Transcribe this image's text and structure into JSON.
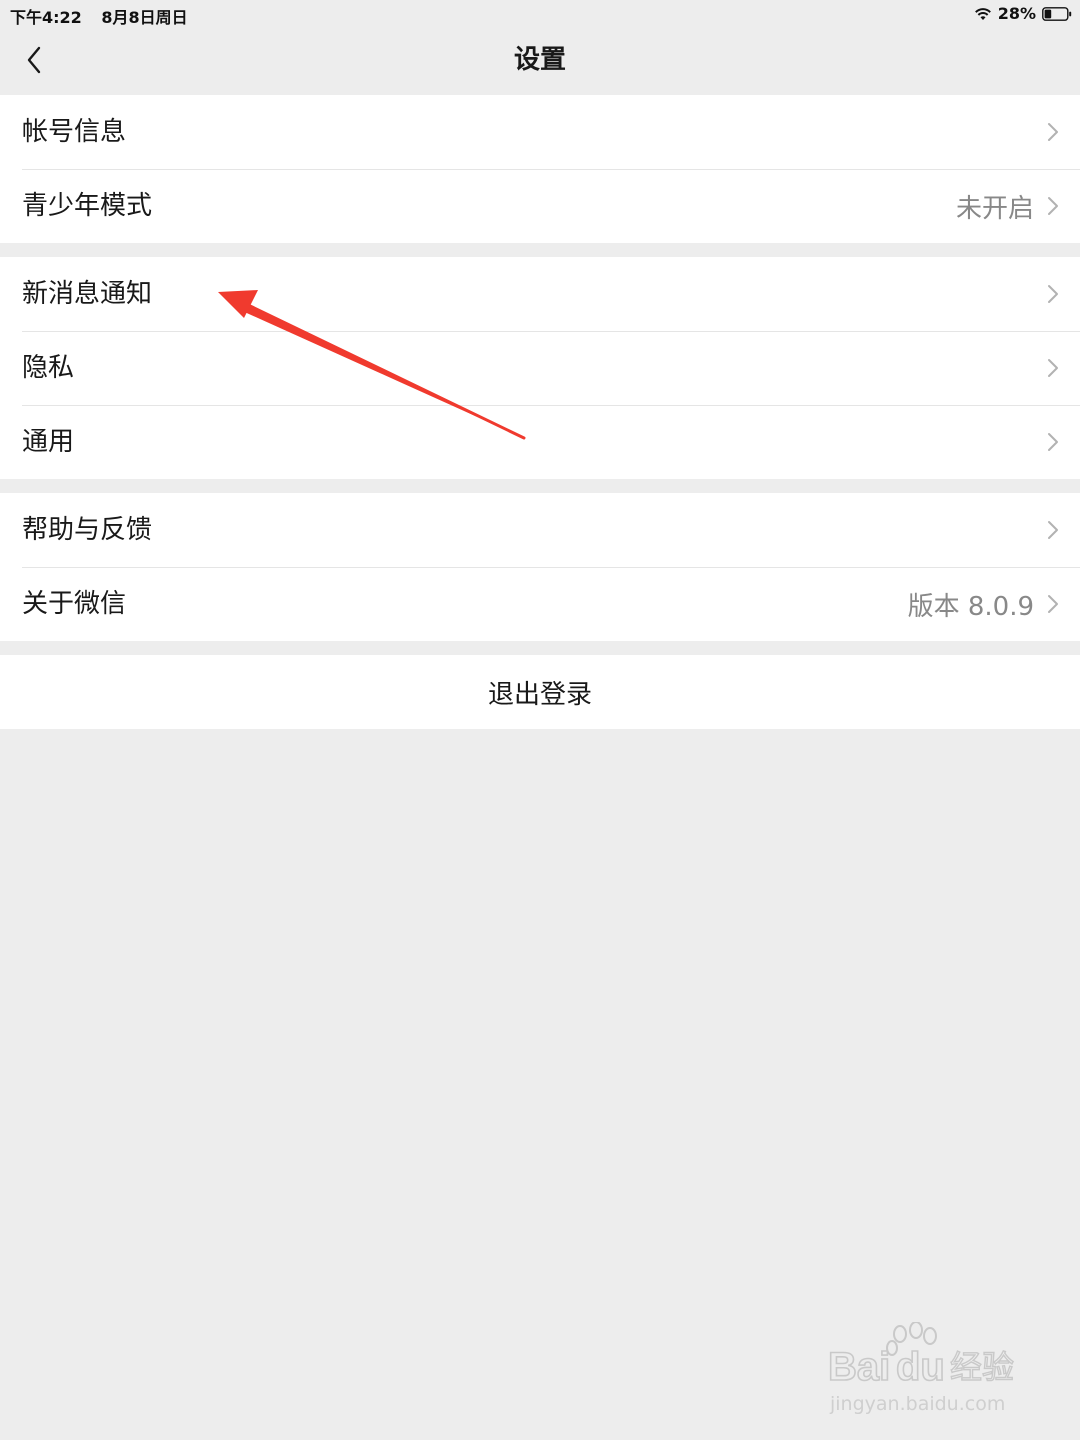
{
  "status_bar": {
    "time": "下午4:22",
    "date": "8月8日周日",
    "battery": "28%"
  },
  "nav": {
    "title": "设置"
  },
  "groups": [
    {
      "items": [
        {
          "label": "帐号信息",
          "value": ""
        },
        {
          "label": "青少年模式",
          "value": "未开启"
        }
      ]
    },
    {
      "items": [
        {
          "label": "新消息通知",
          "value": ""
        },
        {
          "label": "隐私",
          "value": ""
        },
        {
          "label": "通用",
          "value": ""
        }
      ]
    },
    {
      "items": [
        {
          "label": "帮助与反馈",
          "value": ""
        },
        {
          "label": "关于微信",
          "value": "版本 8.0.9"
        }
      ]
    }
  ],
  "logout": {
    "label": "退出登录"
  },
  "watermark": {
    "brand": "Baidu经验",
    "url": "jingyan.baidu.com"
  },
  "colors": {
    "background": "#ededed",
    "card": "#ffffff",
    "annotation_arrow": "#f03a2e",
    "secondary_text": "#888888"
  },
  "icons": {
    "back": "chevron-left-icon",
    "row_arrow": "chevron-right-icon",
    "wifi": "wifi-icon",
    "battery": "battery-icon"
  }
}
